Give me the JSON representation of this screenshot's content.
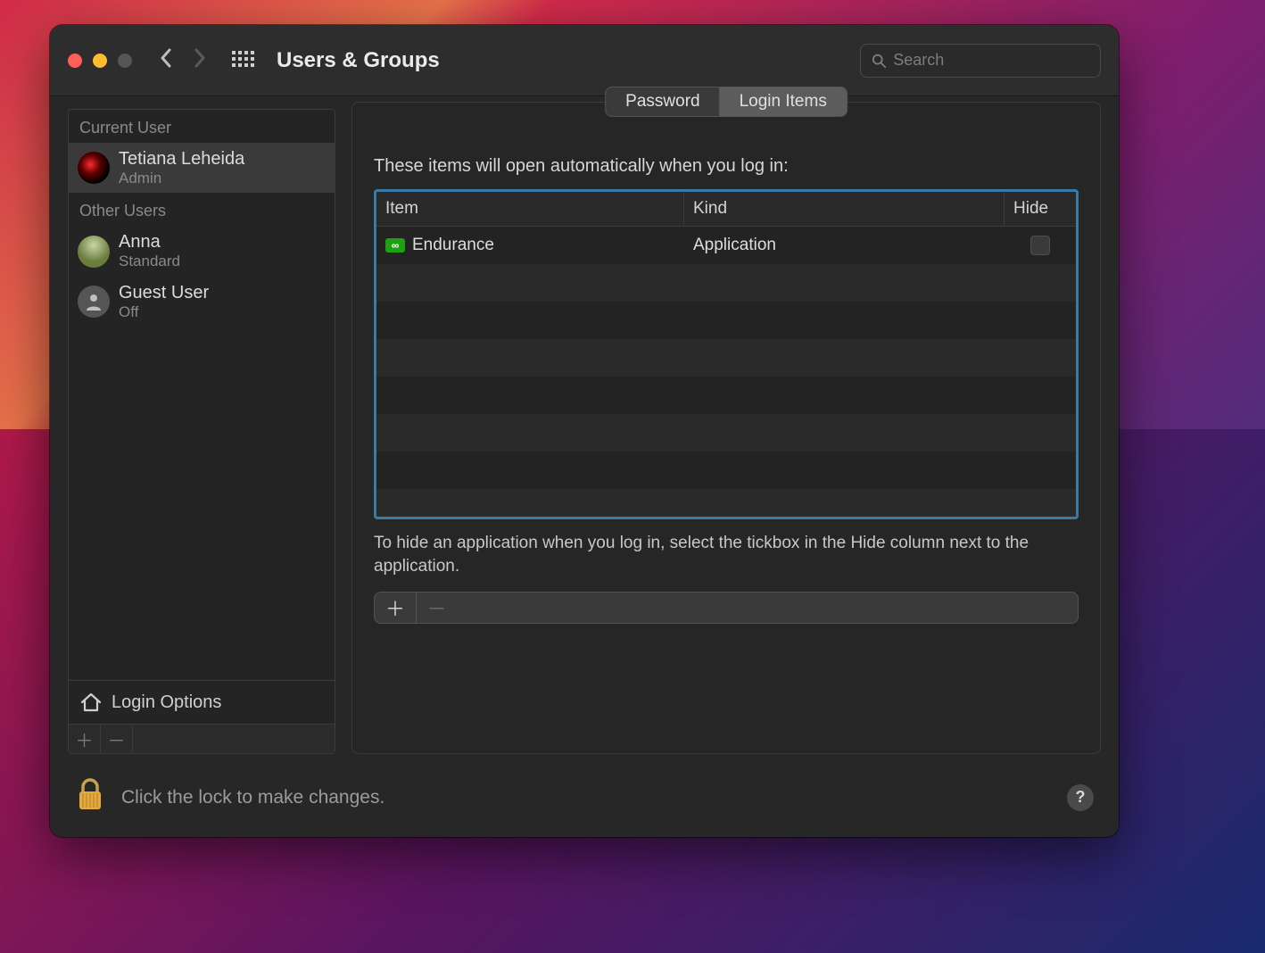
{
  "window": {
    "title": "Users & Groups",
    "search_placeholder": "Search"
  },
  "sidebar": {
    "section_current": "Current User",
    "section_other": "Other Users",
    "current_user": {
      "name": "Tetiana Leheida",
      "role": "Admin"
    },
    "other_users": [
      {
        "name": "Anna",
        "role": "Standard"
      },
      {
        "name": "Guest User",
        "role": "Off"
      }
    ],
    "login_options": "Login Options"
  },
  "tabs": {
    "password": "Password",
    "login_items": "Login Items",
    "active": "login_items"
  },
  "main": {
    "lead": "These items will open automatically when you log in:",
    "columns": {
      "item": "Item",
      "kind": "Kind",
      "hide": "Hide"
    },
    "rows": [
      {
        "icon": "endurance-app-icon",
        "name": "Endurance",
        "kind": "Application",
        "hide": false
      }
    ],
    "hint": "To hide an application when you log in, select the tickbox in the Hide column next to the application."
  },
  "footer": {
    "lock_text": "Click the lock to make changes.",
    "help": "?"
  },
  "glyphs": {
    "infinity": "∞",
    "plus": "＋",
    "minus": "－",
    "person": "👤"
  }
}
